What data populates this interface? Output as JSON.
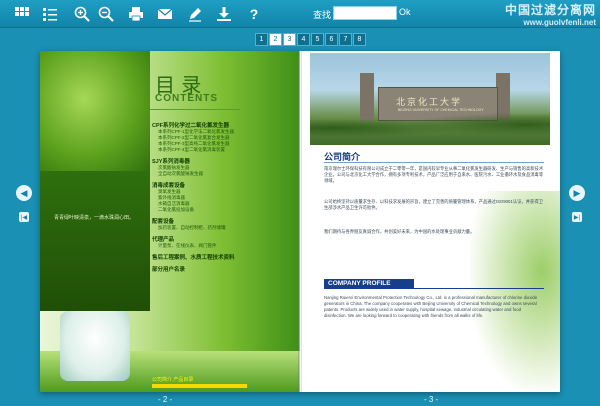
{
  "toolbar": {
    "icons": [
      "thumbnails-icon",
      "list-icon",
      "zoom-in-icon",
      "zoom-out-icon",
      "print-icon",
      "email-icon",
      "edit-icon",
      "download-icon",
      "help-icon"
    ],
    "search_label": "查找",
    "search_placeholder": "",
    "search_button": "Ok"
  },
  "watermark": {
    "line1": "中国过滤分离网",
    "line2": "www.guolvfenli.net"
  },
  "pager": {
    "pages": [
      "1",
      "2",
      "3",
      "4",
      "5",
      "6",
      "7",
      "8"
    ],
    "active": "2"
  },
  "left_page": {
    "toc_title": "目 录",
    "toc_subtitle": "CONTENTS",
    "sections": [
      {
        "title": "CPF系列化学过二氧化氯发生器",
        "items": [
          "本系列CPF-1型化学法二氧化氯发生器",
          "本系列CPF-2型二氧化氯复合发生器",
          "本系列CPF-3型高纯二氧化氯发生器",
          "本系列CPF-4型二氧化氯消毒装置"
        ]
      },
      {
        "title": "SJY系列消毒器",
        "items": [
          "次氯酸钠发生器",
          "全自动次氯酸钠发生器"
        ]
      },
      {
        "title": "消毒成套设备",
        "items": [
          "臭氧发生器",
          "紫外线消毒器",
          "水箱自洁消毒器",
          "二氧化氯投加设备"
        ]
      },
      {
        "title": "配套设备",
        "items": [
          "加药装置、自动控制柜、药剂储罐"
        ]
      },
      {
        "title": "代理产品",
        "items": [
          "计量泵、在线仪表、阀门管件"
        ]
      },
      {
        "title": "售后工程案例、水质工程技术资料",
        "items": []
      },
      {
        "title": "部分用户名录",
        "items": []
      }
    ],
    "poem": "青青绿叶映清泉，一滴水珠润心田。",
    "footer": "公司简介 产品目录"
  },
  "right_page": {
    "gate_title": "北京化工大学",
    "gate_subtitle": "BEIJING UNIVERSITY OF CHEMICAL TECHNOLOGY",
    "section_title": "公司简介",
    "para1": "南京瑞尔士环保科技有限公司成立于二零零一年，是国内较早专业从事二氧化氯发生器研发、生产与销售的高新技术企业。公司与北京化工大学合作，拥有多项专利技术，产品广泛应用于自来水、医院污水、工业循环水及食品消毒等领域。",
    "para2": "公司始终坚持以质量求生存、以科技求发展的宗旨，建立了完善的质量管理体系，产品通过ISO9001认证，并获得卫生部涉水产品卫生许可批件。",
    "para3": "我们期待与各界朋友真诚合作，共创美好未来，为中国的水处理事业贡献力量。",
    "profile_title": "COMPANY PROFILE",
    "profile_text": "Nanjing Ruierxi Environmental Protection Technology Co., Ltd. is a professional manufacturer of chlorine dioxide generators in China. The company cooperates with Beijing University of Chemical Technology and owns several patents. Products are widely used in water supply, hospital sewage, industrial circulating water and food disinfection. We are looking forward to cooperating with friends from all walks of life."
  },
  "page_numbers": {
    "left": "- 2 -",
    "right": "- 3 -"
  }
}
